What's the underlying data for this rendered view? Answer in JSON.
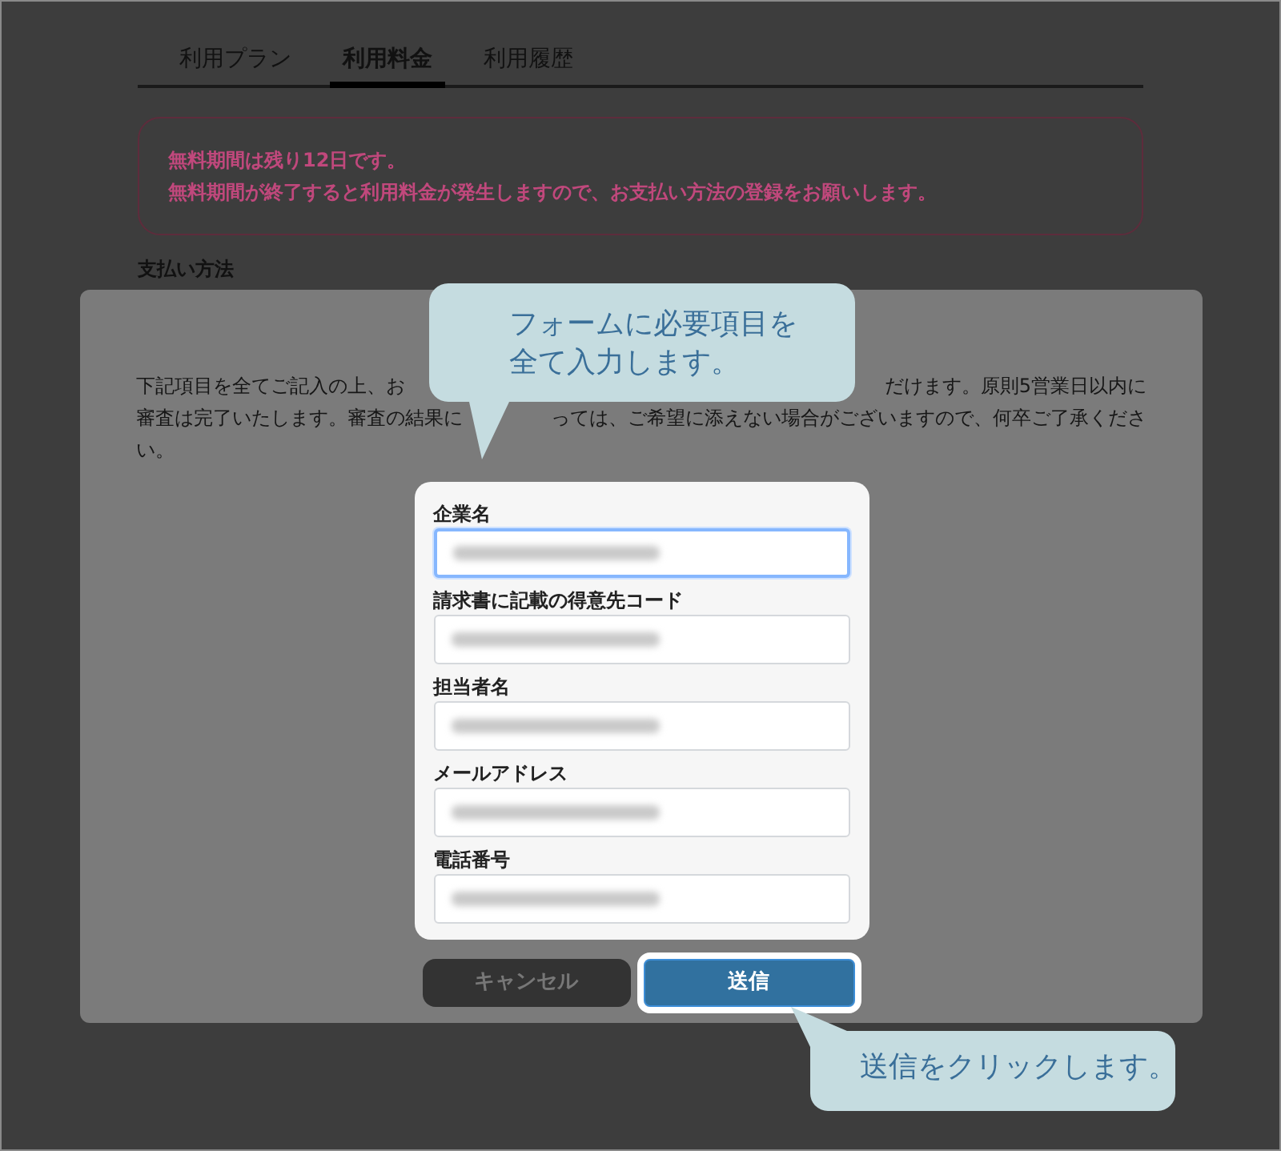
{
  "tabs": [
    {
      "label": "利用プラン",
      "selected": false
    },
    {
      "label": "利用料金",
      "selected": true
    },
    {
      "label": "利用履歴",
      "selected": false
    }
  ],
  "notice": {
    "lines": [
      "無料期間は残り12日です。",
      "無料期間が終了すると利用料金が発生しますので、お支払い方法の登録をお願いします。"
    ]
  },
  "section_title": "支払い方法",
  "modal": {
    "description_lines": [
      [
        "下記項目を全てご記入の上、お",
        "だけます。原則5営業日以内に"
      ],
      [
        "審査は完了いたします。審査の結果に",
        "っては、ご希望に添えない場合がございますので、何卒ご了承くださ"
      ],
      [
        "い。"
      ]
    ],
    "fields": [
      {
        "label": "企業名",
        "focused": true,
        "blurred": true
      },
      {
        "label": "請求書に記載の得意先コード",
        "focused": false,
        "blurred": true
      },
      {
        "label": "担当者名",
        "focused": false,
        "blurred": true
      },
      {
        "label": "メールアドレス",
        "focused": false,
        "blurred": true
      },
      {
        "label": "電話番号",
        "focused": false,
        "blurred": true
      }
    ],
    "buttons": [
      {
        "label": "キャンセル",
        "kind": "secondary",
        "highlighted": false
      },
      {
        "label": "送信",
        "kind": "primary",
        "highlighted": true
      }
    ]
  },
  "callouts": [
    {
      "lines": [
        "フォームに必要項目を",
        "全て入力します。"
      ]
    },
    {
      "lines": [
        "送信をクリックします。"
      ]
    }
  ]
}
